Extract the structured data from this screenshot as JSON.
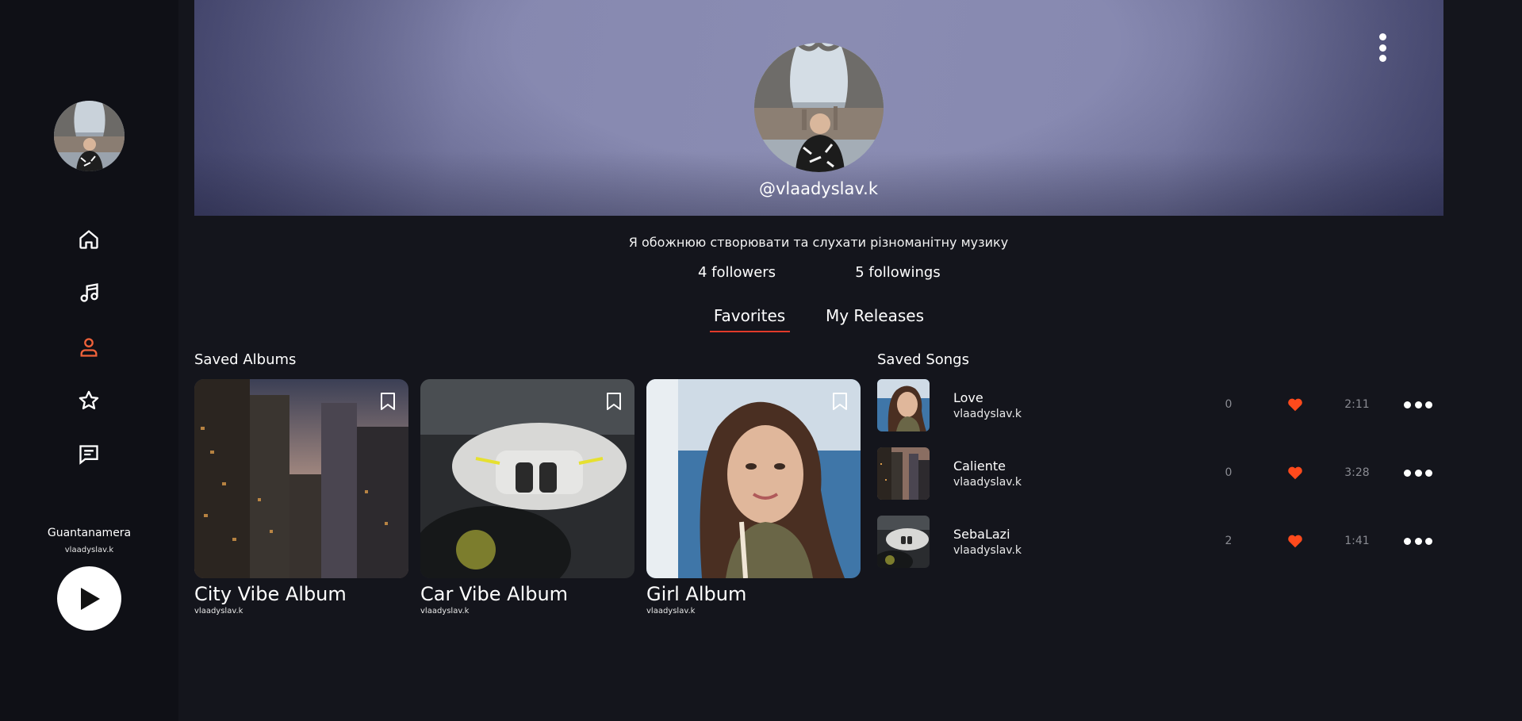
{
  "sidebar": {
    "nav": [
      {
        "icon": "home-icon",
        "active": false
      },
      {
        "icon": "music-note-icon",
        "active": false
      },
      {
        "icon": "user-icon",
        "active": true
      },
      {
        "icon": "star-icon",
        "active": false
      },
      {
        "icon": "chat-icon",
        "active": false
      }
    ],
    "now_playing": {
      "title": "Guantanamera",
      "artist": "vlaadyslav.k"
    }
  },
  "profile": {
    "username": "@vlaadyslav.k",
    "bio": "Я обожнюю створювати та слухати різноманітну музику",
    "followers": "4 followers",
    "followings": "5 followings"
  },
  "tabs": [
    {
      "label": "Favorites",
      "active": true
    },
    {
      "label": "My Releases",
      "active": false
    }
  ],
  "saved_albums": {
    "title": "Saved Albums",
    "items": [
      {
        "title": "City Vibe Album",
        "artist": "vlaadyslav.k"
      },
      {
        "title": "Car Vibe Album",
        "artist": "vlaadyslav.k"
      },
      {
        "title": "Girl Album",
        "artist": "vlaadyslav.k"
      }
    ]
  },
  "saved_songs": {
    "title": "Saved Songs",
    "items": [
      {
        "title": "Love",
        "artist": "vlaadyslav.k",
        "plays": "0",
        "duration": "2:11"
      },
      {
        "title": "Caliente",
        "artist": "vlaadyslav.k",
        "plays": "0",
        "duration": "3:28"
      },
      {
        "title": "SebaLazi",
        "artist": "vlaadyslav.k",
        "plays": "2",
        "duration": "1:41"
      }
    ]
  },
  "colors": {
    "accent": "#ff4a1c",
    "tab_underline": "#e23a2a",
    "nav_active": "#f0623a",
    "background": "#14151c",
    "sidebar": "#0f1016"
  }
}
